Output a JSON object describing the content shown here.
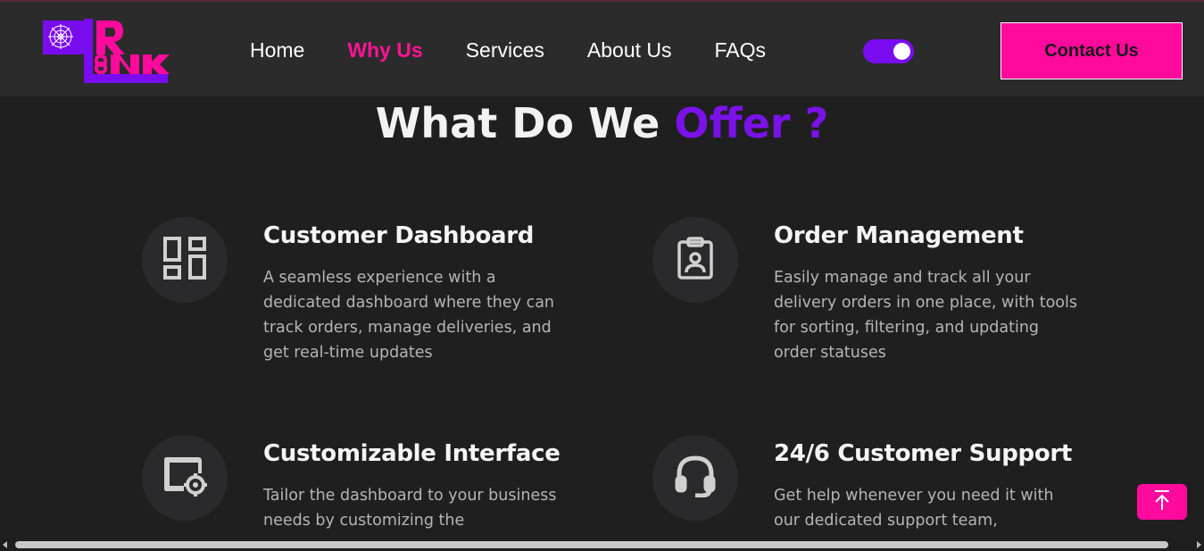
{
  "brand": {
    "logo_name": "DLRLink",
    "logo_letters": "DLRINK",
    "colors": {
      "purple": "#7a0cf0",
      "pink": "#ff0a9c"
    }
  },
  "nav": {
    "items": [
      {
        "label": "Home",
        "active": false
      },
      {
        "label": "Why Us",
        "active": true
      },
      {
        "label": "Services",
        "active": false
      },
      {
        "label": "About Us",
        "active": false
      },
      {
        "label": "FAQs",
        "active": false
      }
    ],
    "theme_toggle": {
      "state": "on"
    },
    "contact_label": "Contact Us"
  },
  "section": {
    "title_main": "What Do We",
    "title_accent": "Offer ?"
  },
  "features": [
    {
      "icon": "dashboard-icon",
      "title": "Customer Dashboard",
      "description": "A seamless experience with a dedicated dashboard where they can track orders, manage deliveries, and get real-time updates"
    },
    {
      "icon": "clipboard-user-icon",
      "title": "Order Management",
      "description": "Easily manage and track all your delivery orders in one place, with tools for sorting, filtering, and updating order statuses"
    },
    {
      "icon": "screen-settings-icon",
      "title": "Customizable Interface",
      "description": "Tailor the dashboard to your business needs by customizing the"
    },
    {
      "icon": "headset-icon",
      "title": "24/6 Customer Support",
      "description": "Get help whenever you need it with our dedicated support team,"
    }
  ],
  "scroll_top": {
    "icon": "arrow-up-to-top-icon"
  }
}
